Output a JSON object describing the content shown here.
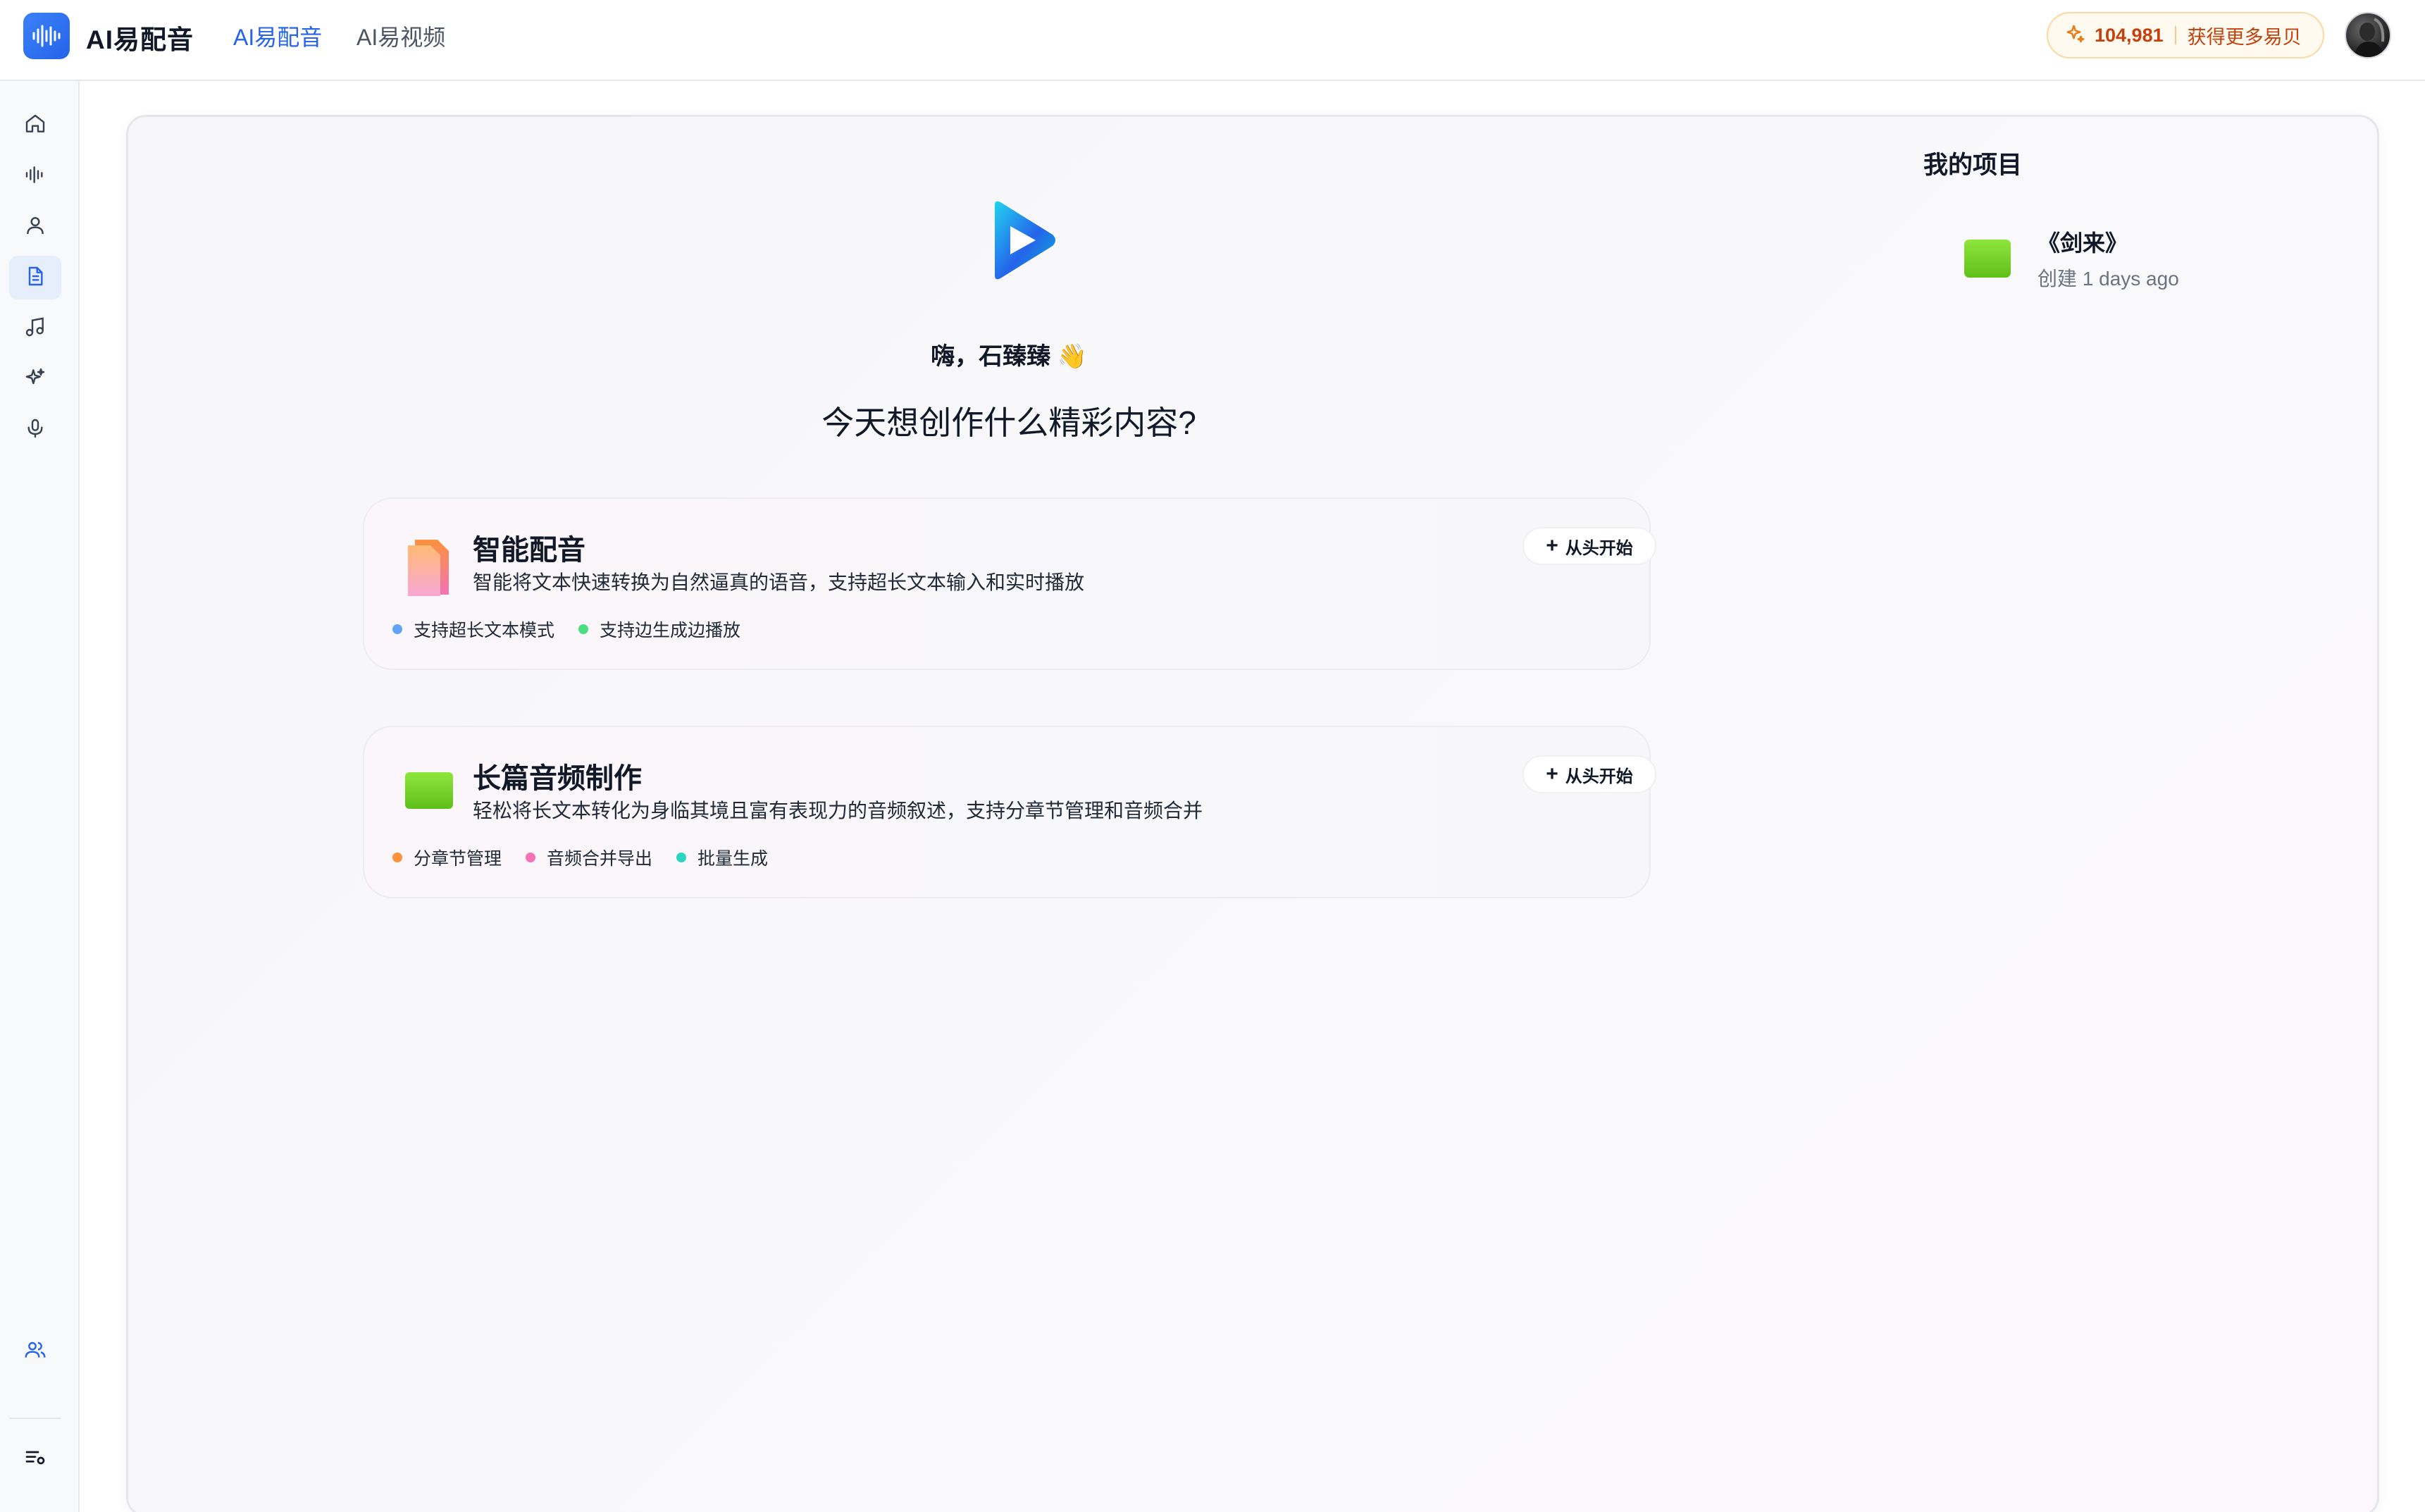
{
  "header": {
    "app_title": "AI易配音",
    "tabs": [
      {
        "label": "AI易配音",
        "active": true
      },
      {
        "label": "AI易视频",
        "active": false
      }
    ],
    "credits": {
      "amount": "104,981",
      "cta": "获得更多易贝",
      "icon": "sparkle-icon"
    },
    "avatar": "user-avatar"
  },
  "sidebar": {
    "items": [
      {
        "name": "home",
        "icon": "home-icon"
      },
      {
        "name": "voice",
        "icon": "waveform-icon"
      },
      {
        "name": "user",
        "icon": "user-icon"
      },
      {
        "name": "document",
        "icon": "document-icon",
        "active": true
      },
      {
        "name": "music",
        "icon": "music-note-icon"
      },
      {
        "name": "magic",
        "icon": "sparkles-icon"
      },
      {
        "name": "microphone",
        "icon": "microphone-icon"
      }
    ],
    "bottom": [
      {
        "name": "team",
        "icon": "users-icon"
      },
      {
        "name": "menu",
        "icon": "list-settings-icon"
      }
    ]
  },
  "main": {
    "greeting": "嗨，石臻臻 👋",
    "headline": "今天想创作什么精彩内容?",
    "cards": [
      {
        "title": "智能配音",
        "description": "智能将文本快速转换为自然逼真的语音，支持超长文本输入和实时播放",
        "button": "从头开始",
        "tags": [
          {
            "label": "支持超长文本模式",
            "color": "#60a5fa"
          },
          {
            "label": "支持边生成边播放",
            "color": "#4ade80"
          }
        ]
      },
      {
        "title": "长篇音频制作",
        "description": "轻松将长文本转化为身临其境且富有表现力的音频叙述，支持分章节管理和音频合并",
        "button": "从头开始",
        "tags": [
          {
            "label": "分章节管理",
            "color": "#fb923c"
          },
          {
            "label": "音频合并导出",
            "color": "#f472b6"
          },
          {
            "label": "批量生成",
            "color": "#2dd4bf"
          }
        ]
      }
    ]
  },
  "projects": {
    "title": "我的项目",
    "items": [
      {
        "name": "《剑来》",
        "meta": "创建 1 days ago"
      }
    ]
  }
}
